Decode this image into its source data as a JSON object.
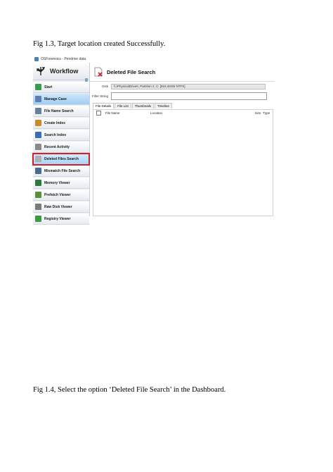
{
  "captions": {
    "fig13": "Fig 1.3, Target location created Successfully.",
    "fig14": "Fig 1.4, Select the option ‘Deleted File Search’ in the Dashboard."
  },
  "screenshot": {
    "window_title": "OSForensics - Pendrive data",
    "sidebar": {
      "title": "Workflow",
      "items": [
        {
          "label": "Start",
          "icon": "start-icon",
          "color": "#3c9a4a"
        },
        {
          "label": "Manage Case",
          "icon": "case-icon",
          "color": "#5a7fb0",
          "state": "highlighted"
        },
        {
          "label": "File Name Search",
          "icon": "file-search-icon",
          "color": "#6b7f99"
        },
        {
          "label": "Create Index",
          "icon": "index-icon",
          "color": "#cc8a2a"
        },
        {
          "label": "Search Index",
          "icon": "search-index-icon",
          "color": "#3a6fb5"
        },
        {
          "label": "Recent Activity",
          "icon": "activity-icon",
          "color": "#8a8a8a"
        },
        {
          "label": "Deleted Files Search",
          "icon": "deleted-file-icon",
          "color": "#b0b0b0",
          "state": "selected"
        },
        {
          "label": "Mismatch File Search",
          "icon": "mismatch-icon",
          "color": "#4c6a8a"
        },
        {
          "label": "Memory Viewer",
          "icon": "memory-icon",
          "color": "#2f7a3a"
        },
        {
          "label": "Prefetch Viewer",
          "icon": "prefetch-icon",
          "color": "#5b8f3c"
        },
        {
          "label": "Raw Disk Viewer",
          "icon": "disk-icon",
          "color": "#7a7a7a"
        },
        {
          "label": "Registry Viewer",
          "icon": "registry-icon",
          "color": "#3f9a3f"
        }
      ]
    },
    "main": {
      "title": "Deleted File Search",
      "disk_label": "Disk",
      "disk_value": "\\\\.\\PhysicalDrive0, Partition 2, C: [915.46GB NTFS]",
      "filter_label": "Filter String",
      "filter_value": "",
      "tabs": [
        "File Details",
        "File List",
        "Thumbnails",
        "Timeline"
      ],
      "columns": {
        "name": "File Name",
        "location": "Location",
        "size": "Size",
        "type": "Type"
      }
    },
    "colors": {
      "selection_outline": "#d0202a",
      "highlight": "#9fcdf3"
    }
  }
}
